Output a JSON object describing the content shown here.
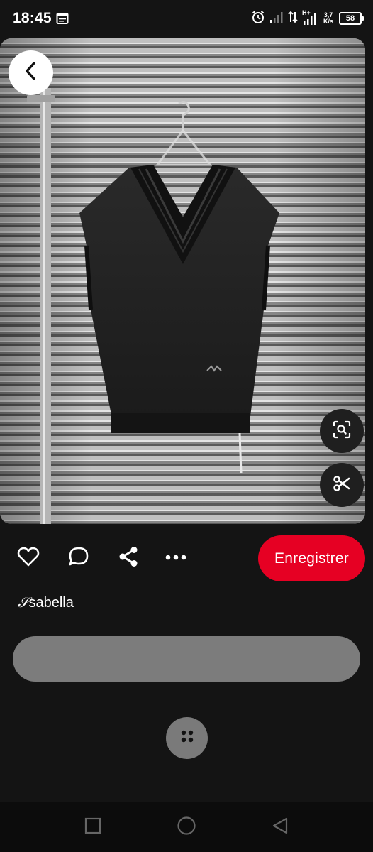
{
  "status_bar": {
    "time": "18:45",
    "network_type": "H+",
    "speed_value": "3,7",
    "speed_unit": "K/s",
    "battery": "58",
    "icons": [
      "calendar-icon",
      "alarm-icon",
      "signal-icon",
      "data-transfer-icon",
      "signal-icon",
      "battery-icon"
    ]
  },
  "pin": {
    "image_description": "black-knit-vneck-sweater-vest-on-hanger",
    "back_icon": "chevron-left-icon",
    "visual_search_icon": "lens-search-icon",
    "cutout_icon": "scissors-icon"
  },
  "actions": {
    "like_icon": "heart-icon",
    "comment_icon": "comment-bubble-icon",
    "share_icon": "share-icon",
    "more_icon": "more-dots-icon",
    "save_label": "Enregistrer",
    "save_color": "#e60023"
  },
  "author": {
    "script_initial": "𝒮",
    "name": "sabella"
  },
  "comment_bar": {
    "placeholder": ""
  },
  "fab": {
    "icon": "four-dots-icon"
  },
  "nav_bar": {
    "recents_icon": "square-icon",
    "home_icon": "circle-icon",
    "back_icon": "triangle-back-icon"
  },
  "colors": {
    "background": "#141414",
    "accent": "#e60023",
    "comment_bar": "#7c7c7c",
    "fab": "#7a7a7a"
  }
}
